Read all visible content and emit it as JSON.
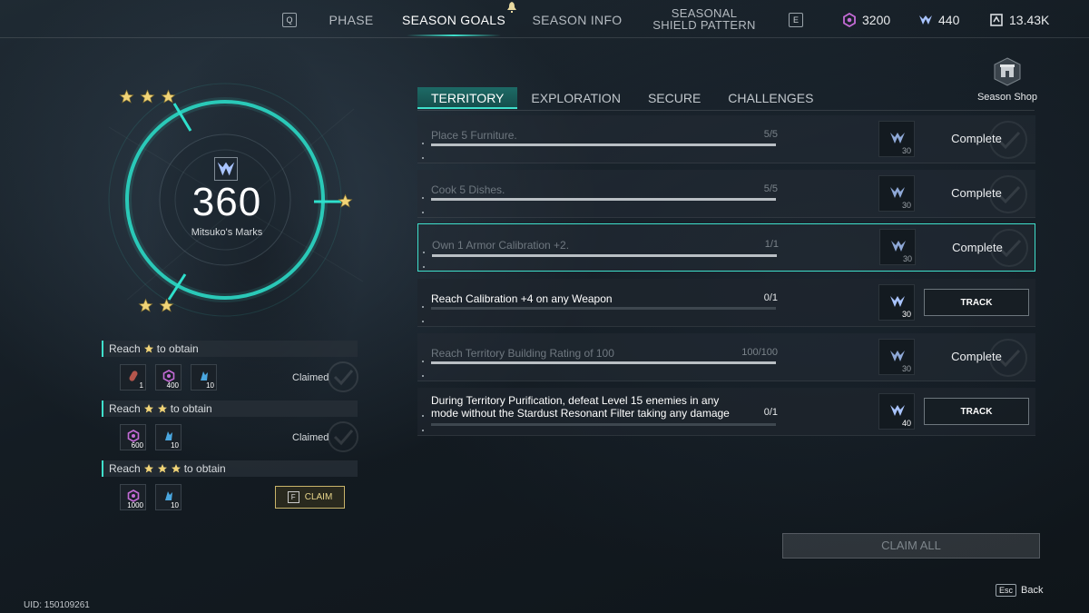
{
  "topbar": {
    "prev_key": "Q",
    "next_key": "E",
    "tabs": [
      {
        "label": "PHASE"
      },
      {
        "label": "SEASON GOALS",
        "active": true
      },
      {
        "label": "SEASON INFO"
      },
      {
        "label_line1": "SEASONAL",
        "label_line2": "SHIELD PATTERN"
      }
    ],
    "currencies": [
      {
        "icon": "purple-hex-currency-icon",
        "value": "3200",
        "color": "#c46bd6"
      },
      {
        "icon": "marks-currency-icon",
        "value": "440",
        "color": "#a9c4ff"
      },
      {
        "icon": "token-currency-icon",
        "value": "13.43K",
        "color": "#d8dce0"
      }
    ]
  },
  "marks": {
    "value": "360",
    "label": "Mitsuko's Marks",
    "accent": "#3fe0cc"
  },
  "milestones": [
    {
      "prefix": "Reach",
      "stars": 1,
      "suffix": "to obtain",
      "status": "Claimed",
      "rewards": [
        {
          "icon": "red-capsule-icon",
          "qty": "1"
        },
        {
          "icon": "purple-hex-currency-icon",
          "qty": "400"
        },
        {
          "icon": "blue-crystal-icon",
          "qty": "10"
        }
      ]
    },
    {
      "prefix": "Reach",
      "stars": 2,
      "suffix": "to obtain",
      "status": "Claimed",
      "rewards": [
        {
          "icon": "purple-hex-currency-icon",
          "qty": "600"
        },
        {
          "icon": "blue-crystal-icon",
          "qty": "10"
        }
      ]
    },
    {
      "prefix": "Reach",
      "stars": 3,
      "suffix": "to obtain",
      "status": "",
      "rewards": [
        {
          "icon": "purple-hex-currency-icon",
          "qty": "1000"
        },
        {
          "icon": "blue-crystal-icon",
          "qty": "10"
        }
      ],
      "claim_key": "F",
      "claim_label": "CLAIM"
    }
  ],
  "goal_tabs": [
    {
      "label": "TERRITORY",
      "active": true
    },
    {
      "label": "EXPLORATION"
    },
    {
      "label": "SECURE"
    },
    {
      "label": "CHALLENGES"
    }
  ],
  "shop": {
    "label": "Season Shop",
    "icon": "shop-icon"
  },
  "goals": [
    {
      "text": "Place 5 Furniture.",
      "progress": "5/5",
      "ratio": 1.0,
      "reward_qty": "30",
      "state": "complete",
      "status": "Complete"
    },
    {
      "text": "Cook 5 Dishes.",
      "progress": "5/5",
      "ratio": 1.0,
      "reward_qty": "30",
      "state": "complete",
      "status": "Complete"
    },
    {
      "text": "Own 1 Armor Calibration +2.",
      "progress": "1/1",
      "ratio": 1.0,
      "reward_qty": "30",
      "state": "complete",
      "status": "Complete",
      "selected": true
    },
    {
      "text": "Reach Calibration +4 on any Weapon",
      "progress": "0/1",
      "ratio": 0.0,
      "reward_qty": "30",
      "state": "track",
      "status": "TRACK"
    },
    {
      "text": "Reach Territory Building Rating of 100",
      "progress": "100/100",
      "ratio": 1.0,
      "reward_qty": "30",
      "state": "complete",
      "status": "Complete"
    },
    {
      "text": "During Territory Purification, defeat Level 15 enemies in any mode without the Stardust Resonant Filter taking any damage",
      "progress": "0/1",
      "ratio": 0.0,
      "reward_qty": "40",
      "state": "track",
      "status": "TRACK"
    }
  ],
  "claim_all_label": "CLAIM ALL",
  "back": {
    "key": "Esc",
    "label": "Back"
  },
  "uid": "UID: 150109261"
}
